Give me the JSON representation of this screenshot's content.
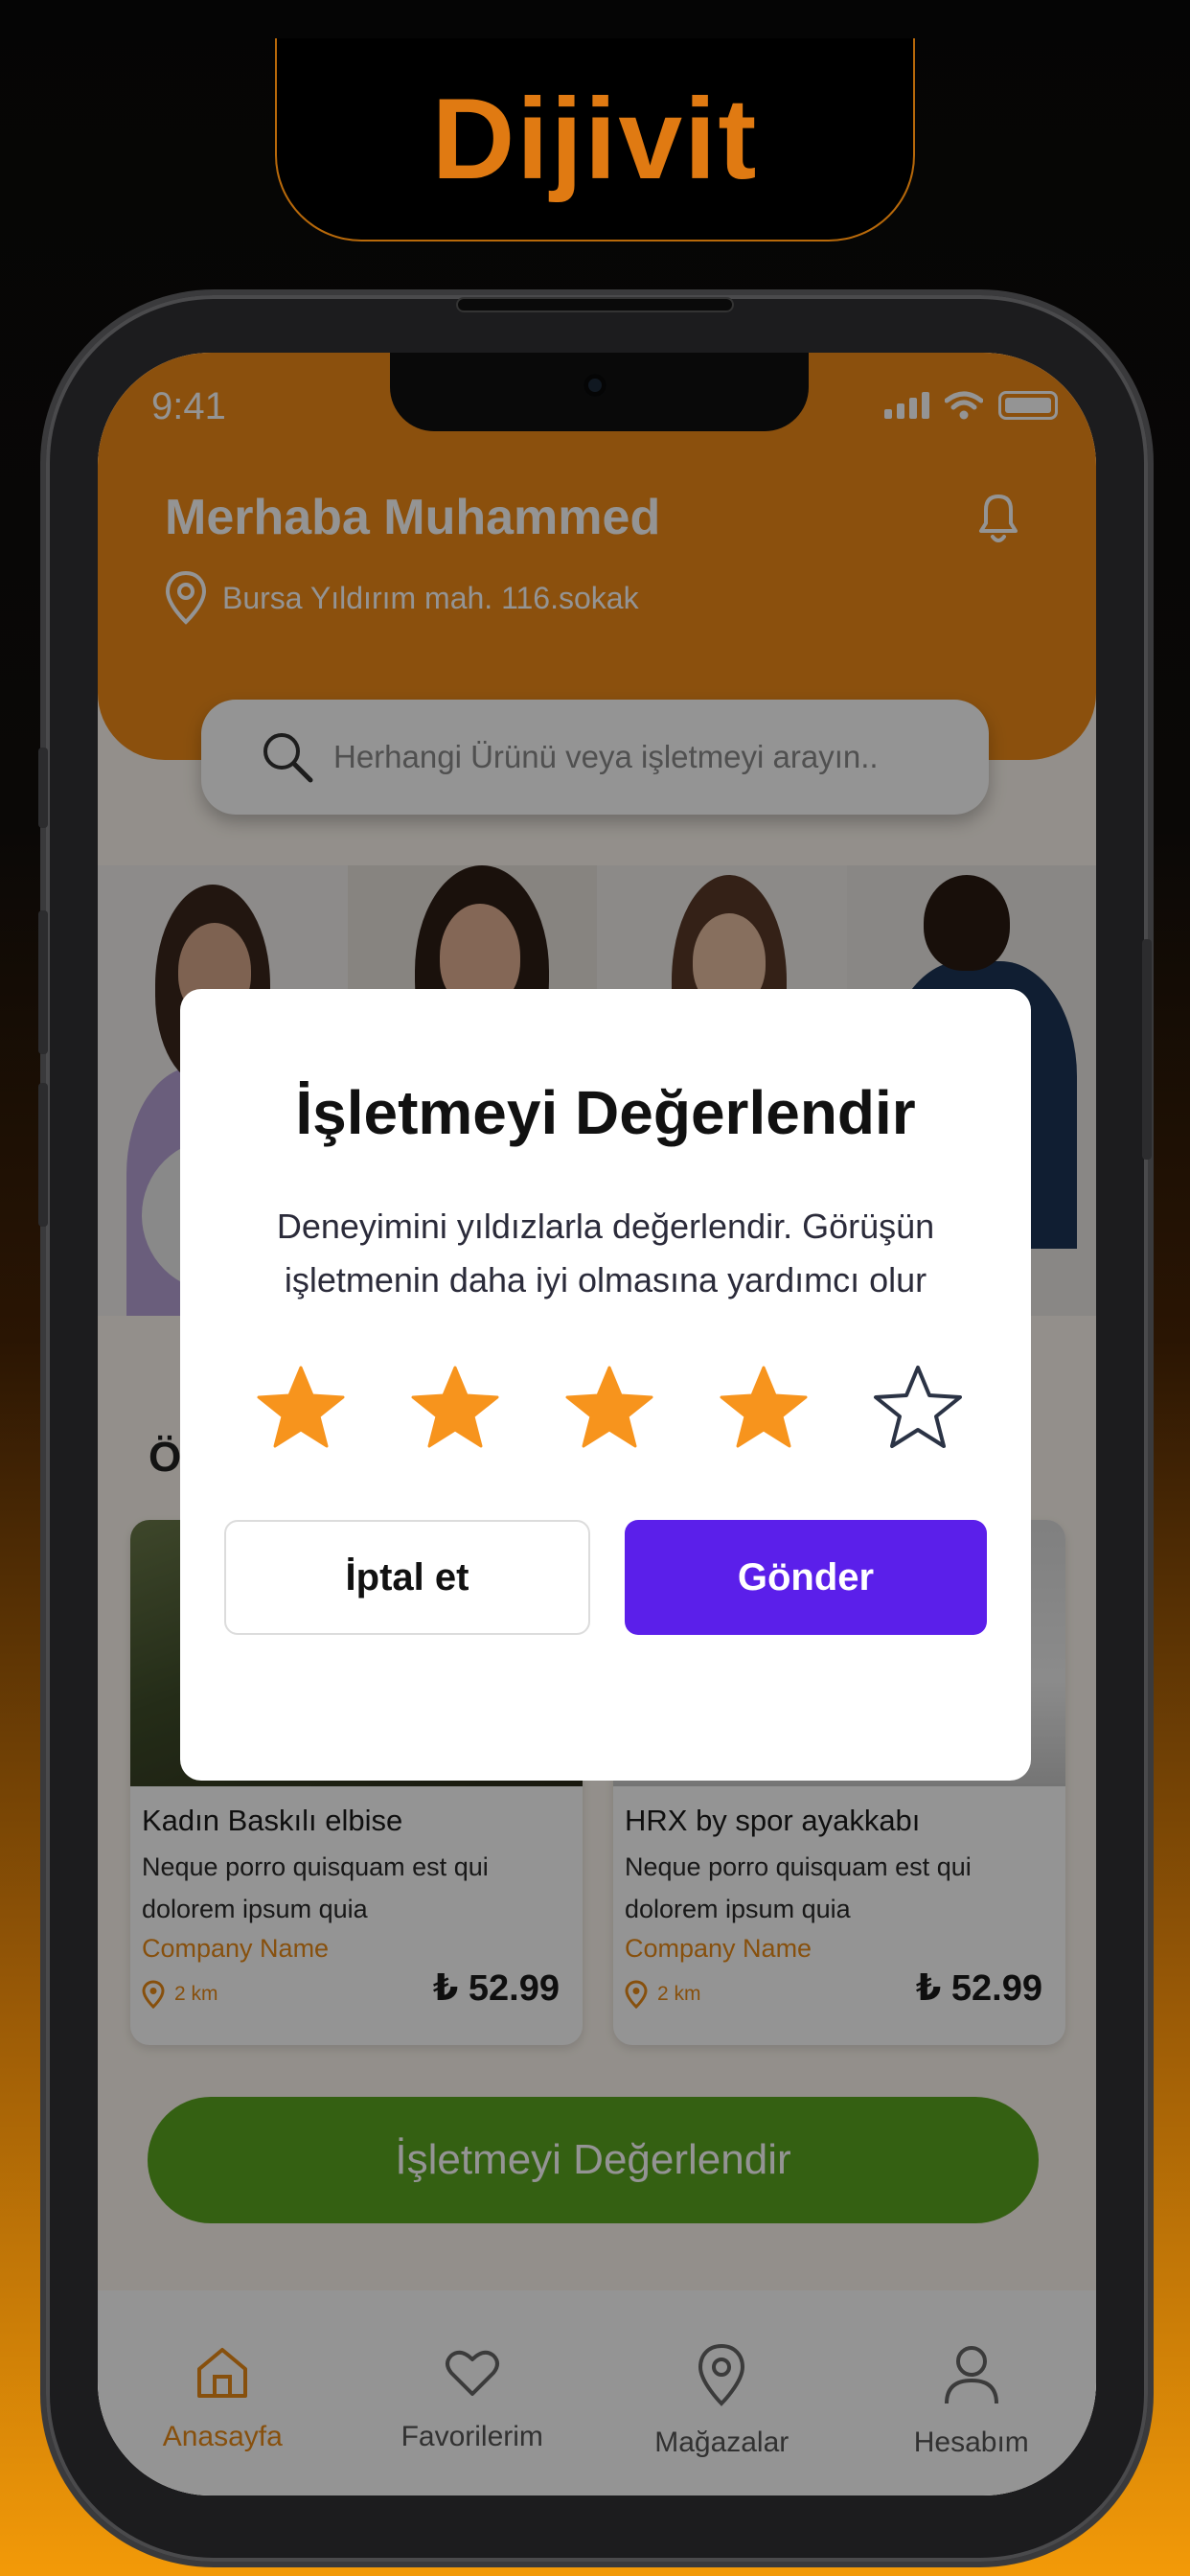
{
  "brand": {
    "title": "Dijivit"
  },
  "status_bar": {
    "time": "9:41"
  },
  "header": {
    "greeting": "Merhaba Muhammed",
    "location": "Bursa Yıldırım mah. 116.sokak"
  },
  "search": {
    "placeholder": "Herhangi  Ürünü veya işletmeyi arayın.."
  },
  "section": {
    "title_visible": "Ö"
  },
  "products": [
    {
      "title": "Kadın Baskılı elbise",
      "description": "Neque porro quisquam est qui dolorem ipsum quia",
      "company": "Company Name",
      "distance": "2 km",
      "price": "₺ 52.99"
    },
    {
      "title": "HRX by spor ayakkabı",
      "description": "Neque porro quisquam est qui dolorem ipsum quia",
      "company": "Company Name",
      "distance": "2 km",
      "price": "₺ 52.99"
    }
  ],
  "rate_button": {
    "label": "İşletmeyi  Değerlendir"
  },
  "tabbar": {
    "items": [
      {
        "label": "Anasayfa",
        "icon": "home-icon",
        "active": true
      },
      {
        "label": "Favorilerim",
        "icon": "heart-icon",
        "active": false
      },
      {
        "label": "Mağazalar",
        "icon": "map-pin-icon",
        "active": false
      },
      {
        "label": "Hesabım",
        "icon": "user-icon",
        "active": false
      }
    ]
  },
  "modal": {
    "title": "İşletmeyi Değerlendir",
    "description": "Deneyimini yıldızlarla değerlendir. Görüşün işletmenin daha iyi olmasına yardımcı olur",
    "rating": 4,
    "max_rating": 5,
    "cancel_label": "İptal et",
    "submit_label": "Gönder"
  },
  "colors": {
    "accent_orange": "#ef8b18",
    "submit_purple": "#5b1fea",
    "rate_green": "#5aa51f",
    "star_filled": "#f7941d"
  }
}
